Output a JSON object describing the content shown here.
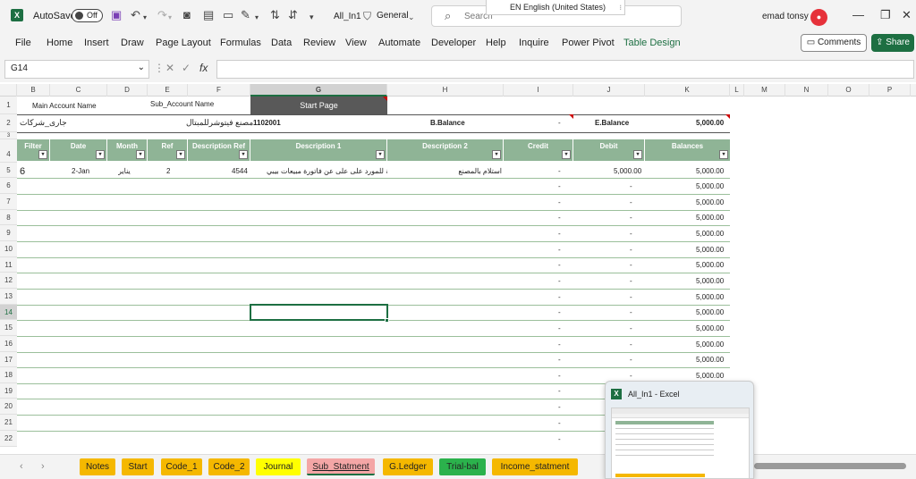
{
  "titlebar": {
    "app_icon": "excel-icon",
    "autosave_label": "AutoSave",
    "autosave_state": "Off",
    "doc_title": "All_In1",
    "number_format": "General",
    "search_placeholder": "Search",
    "language_popup": "EN English (United States)",
    "user_name": "emad tonsy"
  },
  "ribbon": {
    "tabs": [
      "File",
      "Home",
      "Insert",
      "Draw",
      "Page Layout",
      "Formulas",
      "Data",
      "Review",
      "View",
      "Automate",
      "Developer",
      "Help",
      "Inquire",
      "Power Pivot",
      "Table Design"
    ],
    "comments_label": "Comments",
    "share_label": "Share"
  },
  "formula_bar": {
    "name_box": "G14",
    "fx": "fx",
    "value": ""
  },
  "grid": {
    "columns": [
      "B",
      "C",
      "D",
      "E",
      "F",
      "G",
      "H",
      "I",
      "J",
      "K",
      "L",
      "M",
      "N",
      "O",
      "P"
    ],
    "selected_column": "G",
    "rows": [
      "1",
      "2",
      "3",
      "4",
      "5",
      "6",
      "7",
      "8",
      "9",
      "10",
      "11",
      "12",
      "13",
      "14",
      "15",
      "16",
      "17",
      "18",
      "19",
      "20",
      "21",
      "22"
    ],
    "selected_row": "14",
    "row1": {
      "main_account_label": "Main Account Name",
      "sub_account_label": "Sub_Account Name",
      "start_page_button": "Start Page"
    },
    "row2": {
      "main_account": "جارى_شركات",
      "sub_account": "مصنع فيتوشرللمبتال",
      "account_code": "1102001",
      "b_balance_label": "B.Balance",
      "b_balance_value": "-",
      "e_balance_label": "E.Balance",
      "e_balance_value": "5,000.00"
    },
    "table_headers": [
      "Filter",
      "Date",
      "Month",
      "Ref",
      "Description Ref",
      "Description 1",
      "Description 2",
      "Credit",
      "Debit",
      "Balances"
    ],
    "row5": {
      "filter": "6",
      "date": "2-Jan",
      "month": "يناير",
      "ref": "2",
      "desc_ref": "4544",
      "desc1": "دفعة للمورد على على عن فاتورة مبيعات بيبي",
      "desc2": "استلام بالمصنع",
      "credit": "-",
      "debit": "5,000.00",
      "balance": "5,000.00"
    },
    "empty_row": {
      "credit": "-",
      "debit": "-",
      "balance": "5,000.00"
    },
    "row_19_22_credit": "-"
  },
  "sheet_tabs": [
    {
      "label": "Notes",
      "color": "#f5b800"
    },
    {
      "label": "Start",
      "color": "#f5b800"
    },
    {
      "label": "Code_1",
      "color": "#f5b800"
    },
    {
      "label": "Code_2",
      "color": "#f5b800"
    },
    {
      "label": "Journal",
      "color": "#ffff00"
    },
    {
      "label": "Sub_Statment",
      "color": "#f4a6a6",
      "active": true
    },
    {
      "label": "G.Ledger",
      "color": "#f5b800"
    },
    {
      "label": "Trial-bal",
      "color": "#2bb24c"
    },
    {
      "label": "Income_statment",
      "color": "#f5b800"
    }
  ],
  "taskbar_thumbnail": {
    "title": "All_In1 - Excel"
  },
  "colors": {
    "excel_green": "#1d6f42",
    "table_header": "#8fb496",
    "avatar": "#e6313a"
  }
}
